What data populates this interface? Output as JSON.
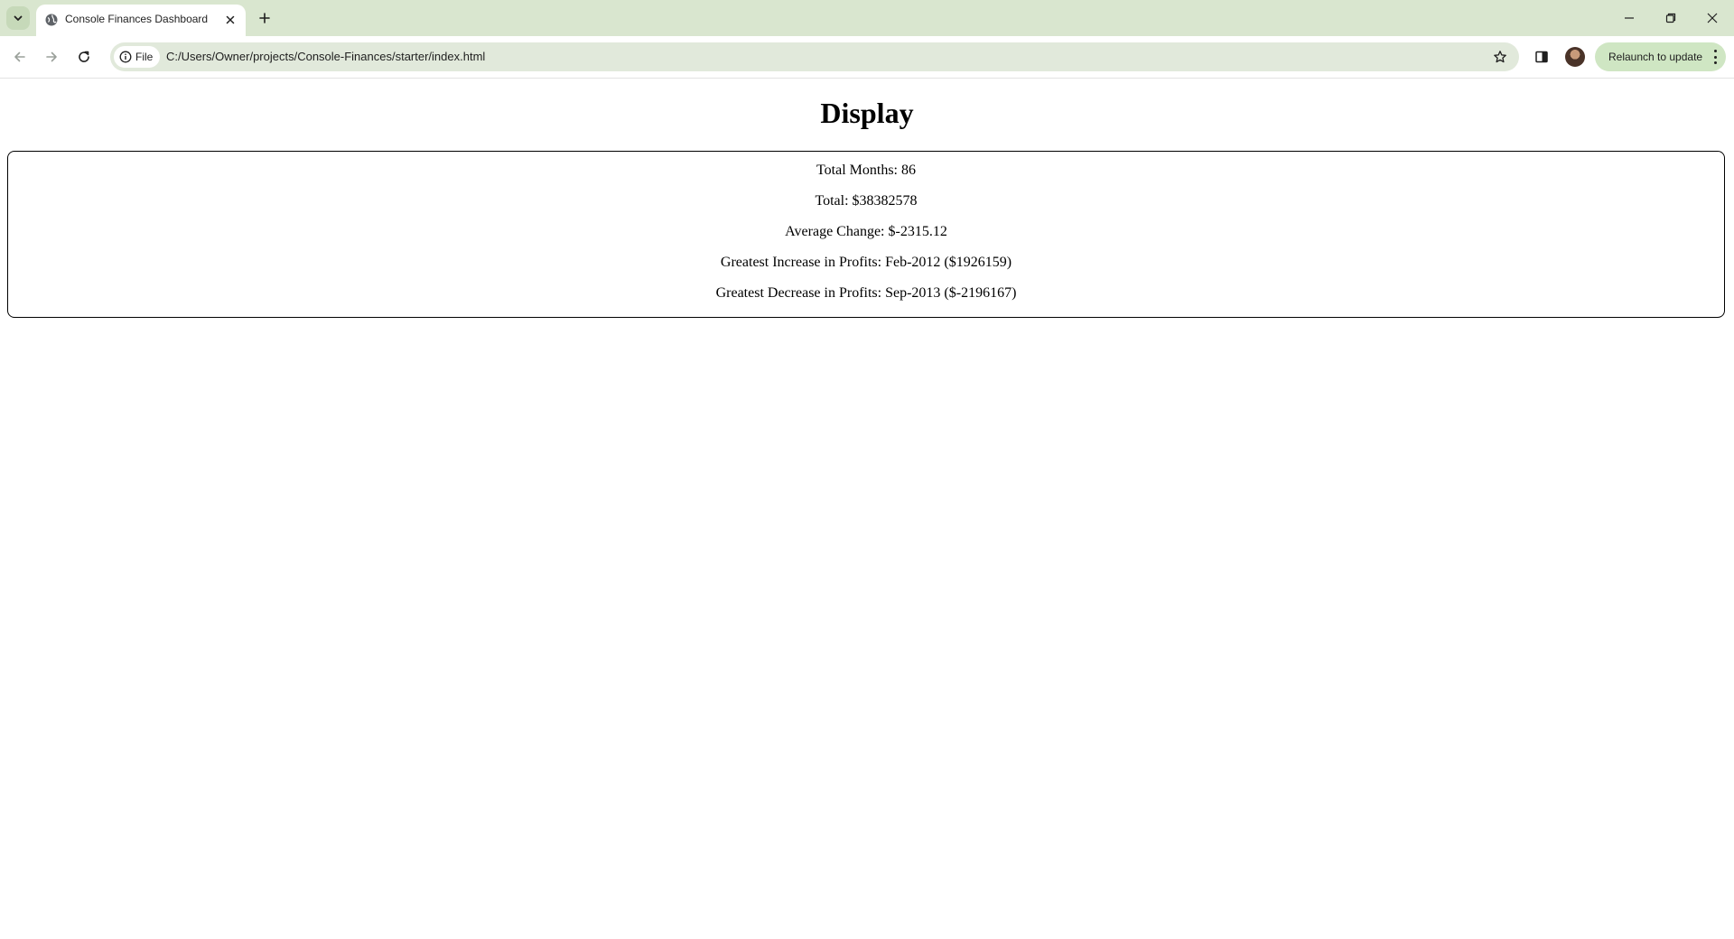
{
  "browser": {
    "tab": {
      "title": "Console Finances Dashboard"
    },
    "address_bar": {
      "site_chip_label": "File",
      "url": "C:/Users/Owner/projects/Console-Finances/starter/index.html"
    },
    "relaunch_label": "Relaunch to update",
    "accent_color": "#d9e6cf"
  },
  "page": {
    "heading": "Display",
    "results": [
      "Total Months: 86",
      "Total: $38382578",
      "Average Change: $-2315.12",
      "Greatest Increase in Profits: Feb-2012 ($1926159)",
      "Greatest Decrease in Profits: Sep-2013 ($-2196167)"
    ]
  }
}
